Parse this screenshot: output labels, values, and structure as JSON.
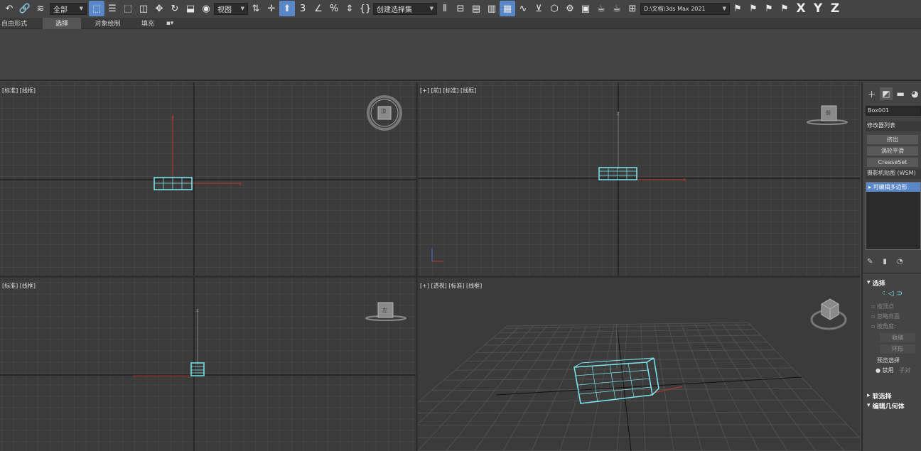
{
  "toolbar": {
    "selection_filter": "全部",
    "reference_coord": "视图",
    "named_selection": "创建选择集",
    "project_path": "D:\\文档\\3ds Max 2021",
    "axis_x": "X",
    "axis_y": "Y",
    "axis_z": "Z"
  },
  "ribbon": {
    "tabs": [
      {
        "label": "自由形式"
      },
      {
        "label": "选择"
      },
      {
        "label": "对象绘制"
      },
      {
        "label": "填充"
      }
    ],
    "active_tab": "选择"
  },
  "viewports": {
    "top_left": {
      "label": "[标准] [线框]",
      "cube_label": "顶"
    },
    "top_right": {
      "label": "[+] [前] [标准] [线框]",
      "cube_label": "前"
    },
    "bottom_left": {
      "label": "[标准] [线框]",
      "cube_label": "左"
    },
    "bottom_right": {
      "label": "[+] [透视] [标准] [线框]"
    }
  },
  "command_panel": {
    "object_name": "Box001",
    "modifier_list": "修改器列表",
    "buttons": [
      "挤出",
      "涡轮平滑",
      "CreaseSet"
    ],
    "wsm_label": "摄影机贴图 (WSM)",
    "stack_item": "可编辑多边形",
    "selection_section": "选择",
    "options": [
      "按顶点",
      "忽略背面",
      "按角度:",
      "收缩",
      "环形"
    ],
    "preview_label": "预览选择",
    "preview_disabled": "禁用",
    "preview_sub": "子对",
    "soft_selection": "软选择",
    "edit_geometry": "编辑几何体"
  }
}
